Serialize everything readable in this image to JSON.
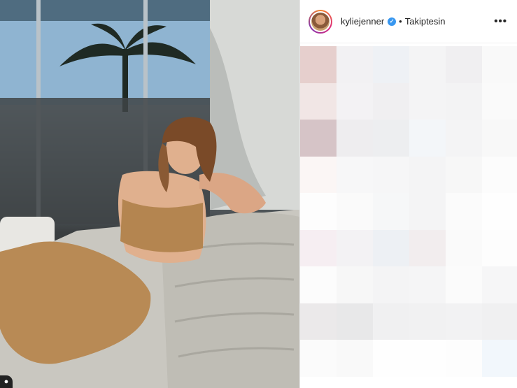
{
  "post": {
    "username": "kyliejenner",
    "separator": "•",
    "follow_status": "Takiptesin",
    "more_icon": "more-horizontal-icon",
    "verified_icon": "verified-badge-icon"
  },
  "photo": {
    "alt_icon": "tagged-user-icon"
  },
  "blur_colors": [
    "#e6cfcd",
    "#f2f1f3",
    "#eef1f5",
    "#f4f4f5",
    "#f0eff1",
    "#f9f9f9",
    "#f1e6e5",
    "#f3f2f4",
    "#f0eff1",
    "#f4f4f5",
    "#f3f3f4",
    "#fafafa",
    "#d6c4c7",
    "#eeedef",
    "#edeef0",
    "#f3f6f9",
    "#f4f4f5",
    "#f8f8f8",
    "#fbf6f5",
    "#f7f7f8",
    "#f6f6f7",
    "#f4f4f5",
    "#f7f7f7",
    "#fcfcfc",
    "#fdfdfd",
    "#fafafa",
    "#f6f7f8",
    "#f4f4f5",
    "#fbfbfb",
    "#fefefe",
    "#f6eef2",
    "#f3f2f4",
    "#edf0f4",
    "#f2edee",
    "#fafafa",
    "#fdfdfd",
    "#fcfcfc",
    "#f7f7f7",
    "#f4f4f5",
    "#f5f5f6",
    "#fbfbfb",
    "#f6f6f7",
    "#ebe9ea",
    "#e8e8e9",
    "#f0f0f1",
    "#f1f1f2",
    "#f2f2f3",
    "#f0f0f1",
    "#fbfbfb",
    "#f9f9f9",
    "#fefefe",
    "#fefefe",
    "#fdfdfd",
    "#f2f7fc"
  ]
}
